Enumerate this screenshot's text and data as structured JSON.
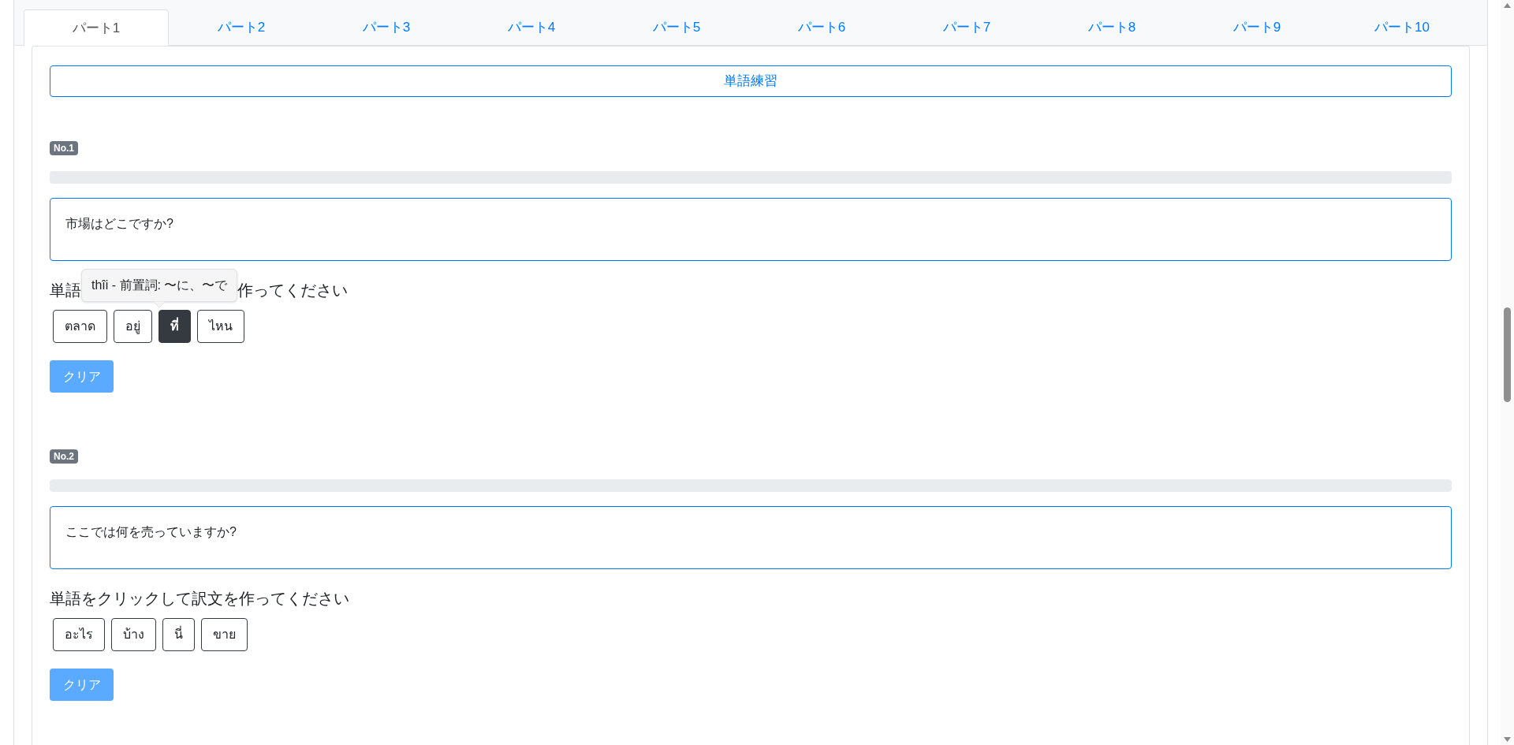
{
  "tabs": [
    {
      "label": "パート1",
      "selected": true
    },
    {
      "label": "パート2",
      "selected": false
    },
    {
      "label": "パート3",
      "selected": false
    },
    {
      "label": "パート4",
      "selected": false
    },
    {
      "label": "パート5",
      "selected": false
    },
    {
      "label": "パート6",
      "selected": false
    },
    {
      "label": "パート7",
      "selected": false
    },
    {
      "label": "パート8",
      "selected": false
    },
    {
      "label": "パート9",
      "selected": false
    },
    {
      "label": "パート10",
      "selected": false
    }
  ],
  "practice_button": "単語練習",
  "questions": [
    {
      "badge": "No.1",
      "level": 0,
      "sentence": "市場はどこですか?",
      "instruction_parts": [
        "単語",
        "作ってください"
      ],
      "tooltip": "thîi - 前置詞: 〜に、〜で",
      "words": [
        {
          "label": "ตลาด",
          "selected": false
        },
        {
          "label": "อยู่",
          "selected": false
        },
        {
          "label": "ที่",
          "selected": true
        },
        {
          "label": "ไหน",
          "selected": false
        }
      ],
      "clear_button": "クリア"
    },
    {
      "badge": "No.2",
      "level": 0,
      "sentence": "ここでは何を売っていますか?",
      "instruction_parts": [
        "単語をクリックして訳文を作ってください"
      ],
      "words": [
        {
          "label": "อะไร",
          "selected": false
        },
        {
          "label": "บ้าง",
          "selected": false
        },
        {
          "label": "นี่",
          "selected": false
        },
        {
          "label": "ขาย",
          "selected": false
        }
      ],
      "clear_button": "クリア"
    }
  ]
}
